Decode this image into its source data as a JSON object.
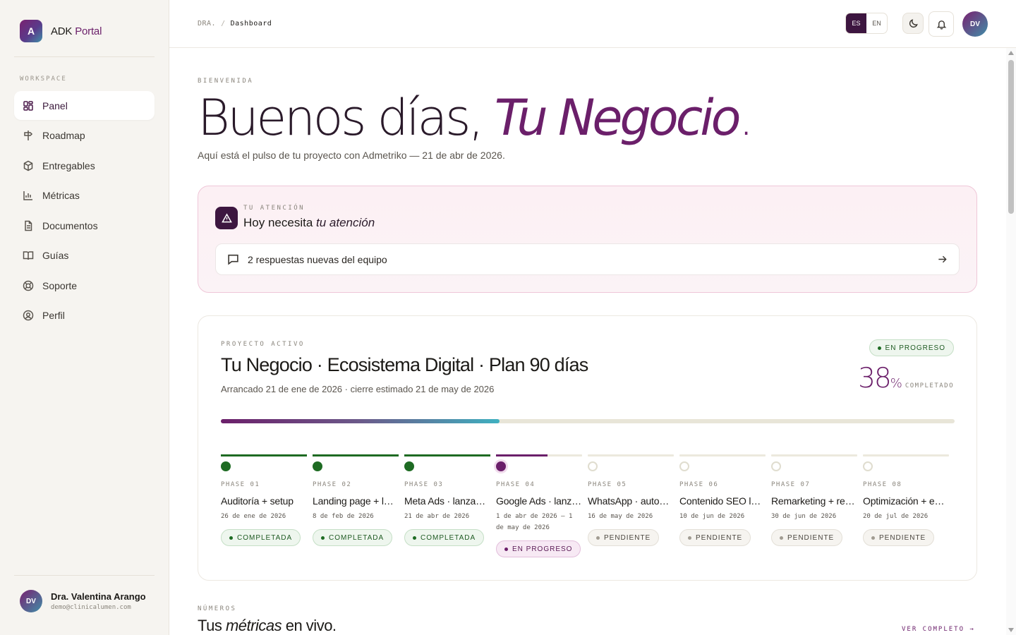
{
  "brand": {
    "logo_letter": "A",
    "name_prefix": "ADK",
    "name_suffix": "Portal"
  },
  "sidebar": {
    "section": "WORKSPACE",
    "items": [
      {
        "label": "Panel",
        "icon": "grid-icon"
      },
      {
        "label": "Roadmap",
        "icon": "signpost-icon"
      },
      {
        "label": "Entregables",
        "icon": "package-icon"
      },
      {
        "label": "Métricas",
        "icon": "bar-chart-icon"
      },
      {
        "label": "Documentos",
        "icon": "document-icon"
      },
      {
        "label": "Guías",
        "icon": "book-icon"
      },
      {
        "label": "Soporte",
        "icon": "lifebuoy-icon"
      },
      {
        "label": "Perfil",
        "icon": "user-circle-icon"
      }
    ],
    "user": {
      "initials": "DV",
      "name": "Dra. Valentina Arango",
      "email": "demo@clinicalumen.com"
    }
  },
  "topbar": {
    "breadcrumb": [
      "DRA.",
      "/",
      "Dashboard"
    ],
    "lang_es": "ES",
    "lang_en": "EN",
    "avatar": "DV"
  },
  "welcome": {
    "eyebrow": "BIENVENIDA",
    "greeting": "Buenos días,",
    "name": "Tu Negocio",
    "dot": ".",
    "subtitle": "Aquí está el pulso de tu proyecto con Admetriko — 21 de abr de 2026."
  },
  "attention": {
    "eyebrow": "TU ATENCIÓN",
    "title_prefix": "Hoy necesita ",
    "title_em": "tu atención",
    "item": "2 respuestas nuevas del equipo"
  },
  "project": {
    "eyebrow": "PROYECTO ACTIVO",
    "title": "Tu Negocio · Ecosistema Digital · Plan 90 días",
    "subtitle": "Arrancado 21 de ene de 2026 · cierre estimado 21 de may de 2026",
    "status": "EN PROGRESO",
    "percent": "38",
    "percent_symbol": "%",
    "percent_label": "COMPLETADO",
    "progress": 0.38,
    "phases": [
      {
        "label": "PHASE 01",
        "name": "Auditoría + setup",
        "date": "26 de ene de 2026",
        "status": "COMPLETADA",
        "state": "done",
        "progress": 1
      },
      {
        "label": "PHASE 02",
        "name": "Landing page + lanzamiento",
        "date": "8 de feb de 2026",
        "status": "COMPLETADA",
        "state": "done",
        "progress": 1
      },
      {
        "label": "PHASE 03",
        "name": "Meta Ads · lanzamiento",
        "date": "21 de abr de 2026",
        "status": "COMPLETADA",
        "state": "done",
        "progress": 1
      },
      {
        "label": "PHASE 04",
        "name": "Google Ads · lanzamiento",
        "date": "1 de abr de 2026 — 1 de may de 2026",
        "status": "EN PROGRESO",
        "state": "progress",
        "progress": 0.6
      },
      {
        "label": "PHASE 05",
        "name": "WhatsApp · automatización",
        "date": "16 de may de 2026",
        "status": "PENDIENTE",
        "state": "pending",
        "progress": 0
      },
      {
        "label": "PHASE 06",
        "name": "Contenido SEO local",
        "date": "10 de jun de 2026",
        "status": "PENDIENTE",
        "state": "pending",
        "progress": 0
      },
      {
        "label": "PHASE 07",
        "name": "Remarketing + reportes",
        "date": "30 de jun de 2026",
        "status": "PENDIENTE",
        "state": "pending",
        "progress": 0
      },
      {
        "label": "PHASE 08",
        "name": "Optimización + escala",
        "date": "20 de jul de 2026",
        "status": "PENDIENTE",
        "state": "pending",
        "progress": 0
      }
    ]
  },
  "numbers": {
    "eyebrow": "NÚMEROS",
    "title_prefix": "Tus ",
    "title_em": "métricas",
    "title_suffix": " en vivo.",
    "link": "VER COMPLETO →"
  },
  "colors": {
    "accent": "#6b1f6a",
    "dark": "#3d1640",
    "success": "#1e6b23",
    "teal": "#3fb0c0"
  }
}
